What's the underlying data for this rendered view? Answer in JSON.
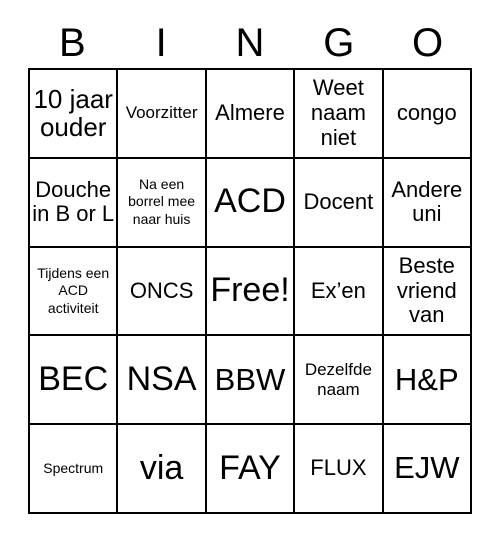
{
  "card": {
    "headers": [
      "B",
      "I",
      "N",
      "G",
      "O"
    ],
    "rows": [
      [
        {
          "text": "10 jaar ouder",
          "size": "lg"
        },
        {
          "text": "Voorzitter",
          "size": "sm"
        },
        {
          "text": "Almere",
          "size": "md"
        },
        {
          "text": "Weet naam niet",
          "size": "md"
        },
        {
          "text": "congo",
          "size": "md"
        }
      ],
      [
        {
          "text": "Douche in B or L",
          "size": "md"
        },
        {
          "text": "Na een borrel mee naar huis",
          "size": "xs"
        },
        {
          "text": "ACD",
          "size": "xxl"
        },
        {
          "text": "Docent",
          "size": "md"
        },
        {
          "text": "Andere uni",
          "size": "md"
        }
      ],
      [
        {
          "text": "Tijdens een ACD activiteit",
          "size": "xs"
        },
        {
          "text": "ONCS",
          "size": "md"
        },
        {
          "text": "Free!",
          "size": "xxl"
        },
        {
          "text": "Ex’en",
          "size": "md"
        },
        {
          "text": "Beste vriend van",
          "size": "md"
        }
      ],
      [
        {
          "text": "BEC",
          "size": "xxl"
        },
        {
          "text": "NSA",
          "size": "xxl"
        },
        {
          "text": "BBW",
          "size": "xl"
        },
        {
          "text": "Dezelfde naam",
          "size": "sm"
        },
        {
          "text": "H&P",
          "size": "xl"
        }
      ],
      [
        {
          "text": "Spectrum",
          "size": "xs"
        },
        {
          "text": "via",
          "size": "xxl"
        },
        {
          "text": "FAY",
          "size": "xxl"
        },
        {
          "text": "FLUX",
          "size": "md"
        },
        {
          "text": "EJW",
          "size": "xl"
        }
      ]
    ],
    "colors": {
      "background": "#ffffff",
      "border": "#000000",
      "text": "#000000"
    }
  }
}
